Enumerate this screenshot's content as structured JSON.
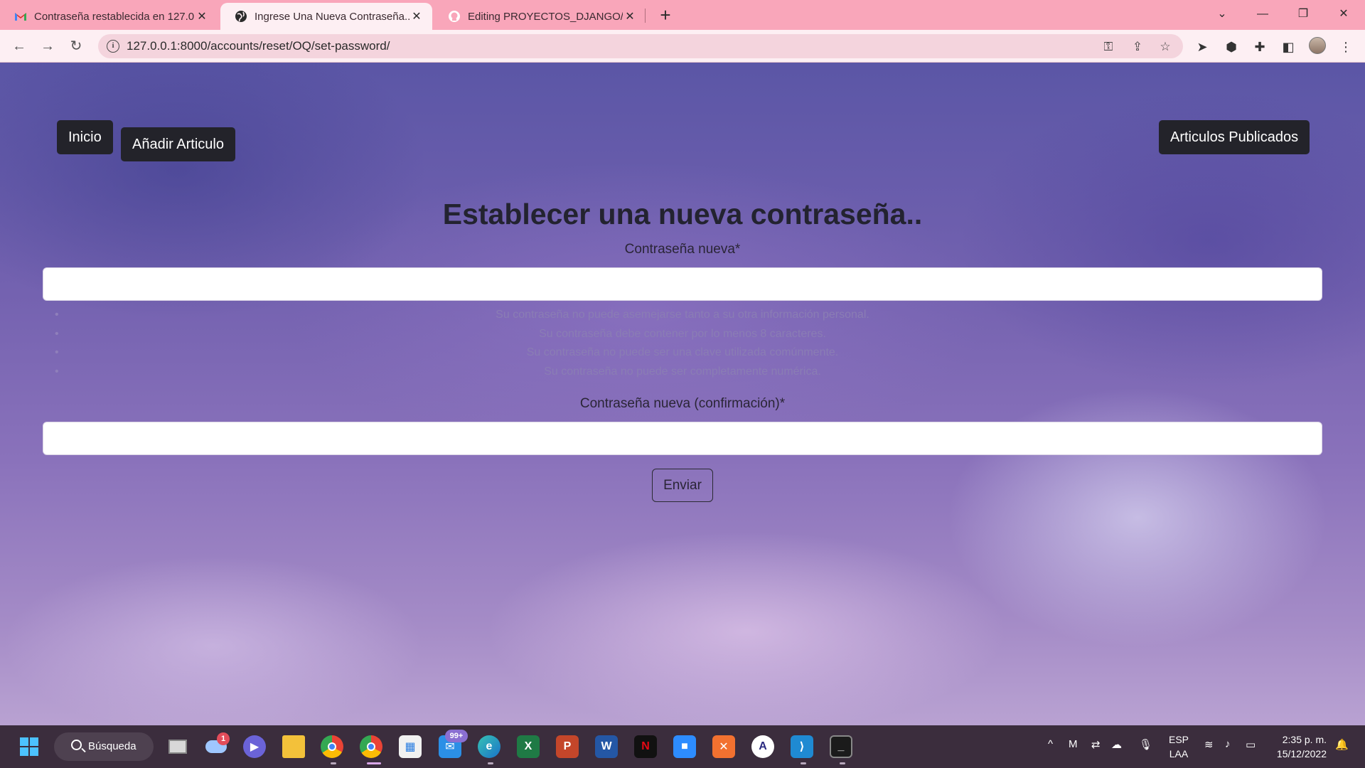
{
  "browser": {
    "tabs": [
      {
        "title": "Contraseña restablecida en 127.0",
        "icon": "gmail-icon"
      },
      {
        "title": "Ingrese Una Nueva Contraseña..",
        "icon": "globe-icon"
      },
      {
        "title": "Editing PROYECTOS_DJANGO/RE",
        "icon": "github-icon"
      }
    ],
    "url": "127.0.0.1:8000/accounts/reset/OQ/set-password/"
  },
  "page": {
    "nav": {
      "home": "Inicio",
      "add_article": "Añadir Articulo",
      "published": "Articulos Publicados"
    },
    "heading": "Establecer una nueva contraseña..",
    "password_label": "Contraseña nueva*",
    "help_items": [
      "Su contraseña no puede asemejarse tanto a su otra información personal.",
      "Su contraseña debe contener por lo menos 8 caracteres.",
      "Su contraseña no puede ser una clave utilizada comúnmente.",
      "Su contraseña no puede ser completamente numérica."
    ],
    "confirm_label": "Contraseña nueva (confirmación)*",
    "submit": "Enviar"
  },
  "taskbar": {
    "search": "Búsqueda",
    "weather_badge": "1",
    "mail_badge": "99+",
    "lang_line1": "ESP",
    "lang_line2": "LAA",
    "time": "2:35 p. m.",
    "date": "15/12/2022"
  },
  "colors": {
    "tabbar": "#f9a6ba",
    "toolbar": "#fdeff3",
    "button_dark": "#23232a",
    "taskbar": "#3b2d3d"
  }
}
